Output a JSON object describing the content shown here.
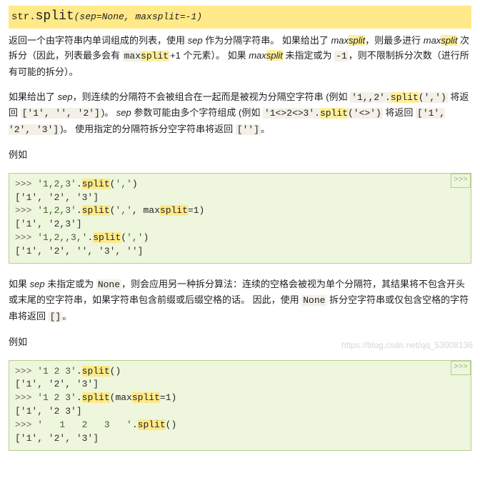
{
  "sig_prefix": "str.",
  "sig_method": "split",
  "sig_params": "(sep=None, maxsplit=-1)",
  "p1_a": "返回一个由字符串内单词组成的列表，使用 ",
  "p1_sep": "sep",
  "p1_b": " 作为分隔字符串。 如果给出了 ",
  "p1_c": "，则最多进行 ",
  "p1_d": " 次拆分（因此，列表最多会有 ",
  "p1_maxsplit_code": "maxsplit",
  "p1_e": "+1 个元素）。 如果 ",
  "p1_f": " 未指定或为 ",
  "p1_neg1": "-1",
  "p1_g": "，则不限制拆分次数（进行所有可能的拆分）。",
  "p2_a": "如果给出了 ",
  "p2_sep": "sep",
  "p2_b": "，则连续的分隔符不会被组合在一起而是被视为分隔空字符串 (例如 ",
  "p2_c1": "'1,,2'.",
  "p2_split": "split",
  "p2_c2": "(',')",
  "p2_d": " 将返回 ",
  "p2_ret1": "['1', '', '2']",
  "p2_e": ")。 ",
  "p2_sep2": "sep",
  "p2_f": " 参数可能由多个字符组成 (例如 ",
  "p2_c3": "'1<>2<>3'.",
  "p2_c4": "('<>')",
  "p2_g": " 将返回 ",
  "p2_ret2": "['1', '2', '3']",
  "p2_h": ")。 使用指定的分隔符拆分空字符串将返回 ",
  "p2_ret3": "['']",
  "p2_i": "。",
  "eg_label": "例如",
  "ex1": {
    "l1p": ">>> ",
    "l1a": "'1,2,3'",
    "l1b": ".",
    "l1c": "split",
    "l1d": "(",
    "l1e": "','",
    "l1f": ")",
    "l2": "['1', '2', '3']",
    "l3p": ">>> ",
    "l3a": "'1,2,3'",
    "l3b": ".",
    "l3c": "split",
    "l3d": "(",
    "l3e": "','",
    "l3f": ", max",
    "l3g": "split",
    "l3h": "=",
    "l3i": "1",
    "l3j": ")",
    "l4": "['1', '2,3']",
    "l5p": ">>> ",
    "l5a": "'1,2,,3,'",
    "l5b": ".",
    "l5c": "split",
    "l5d": "(",
    "l5e": "','",
    "l5f": ")",
    "l6": "['1', '2', '', '3', '']"
  },
  "p3_a": "如果 ",
  "p3_sep": "sep",
  "p3_b": " 未指定或为 ",
  "p3_none": "None",
  "p3_c": "，则会应用另一种拆分算法：连续的空格会被视为单个分隔符，其结果将不包含开头或末尾的空字符串，如果字符串包含前缀或后缀空格的话。 因此，使用 ",
  "p3_d": " 拆分空字符串或仅包含空格的字符串将返回 ",
  "p3_ret": "[]",
  "p3_e": "。",
  "ex2": {
    "l1p": ">>> ",
    "l1a": "'1 2 3'",
    "l1b": ".",
    "l1c": "split",
    "l1d": "()",
    "l2": "['1', '2', '3']",
    "l3p": ">>> ",
    "l3a": "'1 2 3'",
    "l3b": ".",
    "l3c": "split",
    "l3d": "(max",
    "l3e": "split",
    "l3f": "=",
    "l3g": "1",
    "l3h": ")",
    "l4": "['1', '2 3']",
    "l5p": ">>> ",
    "l5a": "'   1   2   3   '",
    "l5b": ".",
    "l5c": "split",
    "l5d": "()",
    "l6": "['1', '2', '3']"
  },
  "btn": ">>>",
  "watermark": "https://blog.csdn.net/qq_53008136"
}
